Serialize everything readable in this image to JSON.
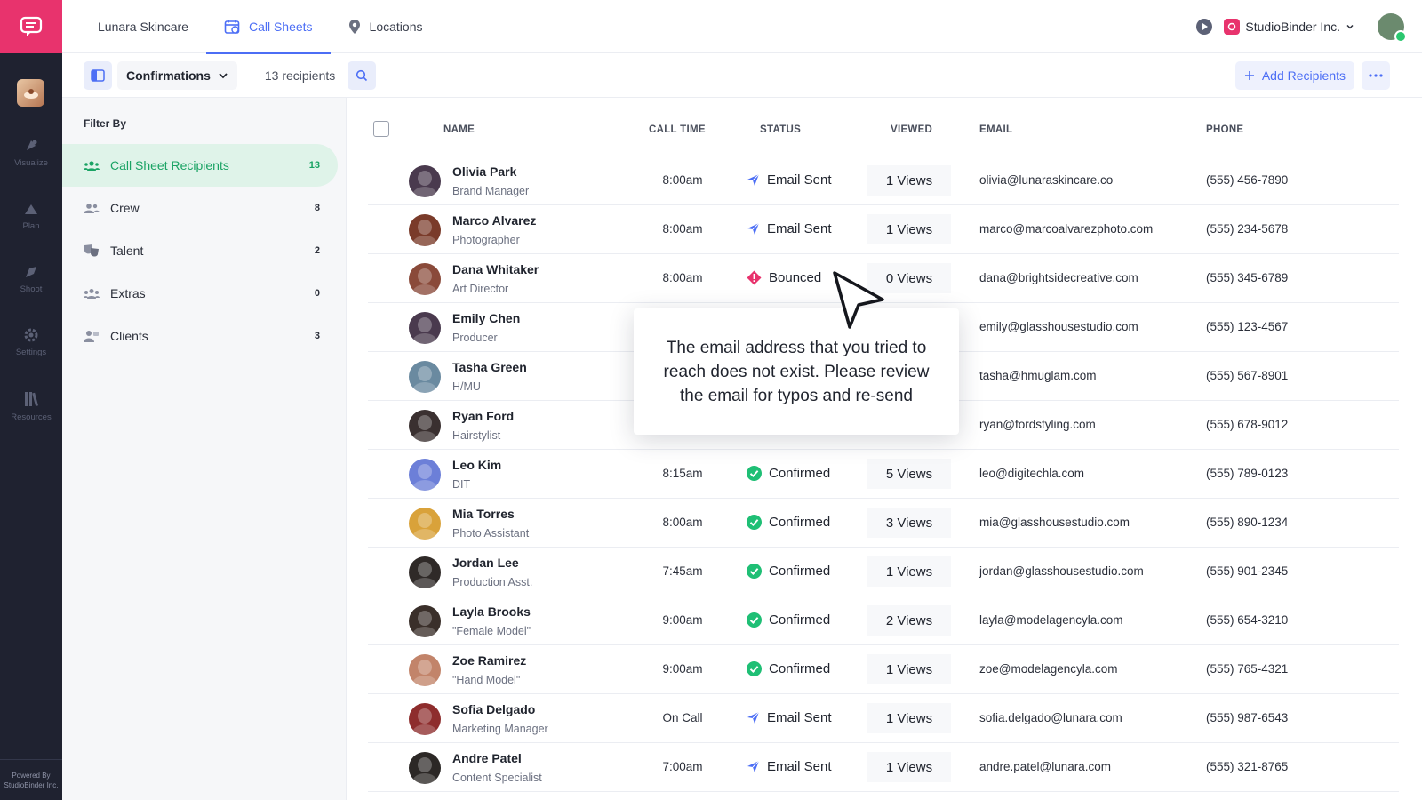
{
  "rail": {
    "items": [
      {
        "label": "Visualize",
        "icon": "visualize-icon"
      },
      {
        "label": "Plan",
        "icon": "plan-icon"
      },
      {
        "label": "Shoot",
        "icon": "shoot-icon"
      },
      {
        "label": "Settings",
        "icon": "gear-icon"
      },
      {
        "label": "Resources",
        "icon": "resources-icon"
      }
    ],
    "powered_line1": "Powered By",
    "powered_line2": "StudioBinder Inc."
  },
  "nav": {
    "project": "Lunara Skincare",
    "tabs": [
      {
        "label": "Call Sheets",
        "icon": "calendar-icon",
        "active": true
      },
      {
        "label": "Locations",
        "icon": "location-pin-icon",
        "active": false
      }
    ],
    "org_name": "StudioBinder Inc."
  },
  "toolbar": {
    "view_label": "Confirmations",
    "recipient_count": "13 recipients",
    "add_label": "Add Recipients"
  },
  "filters": {
    "title": "Filter By",
    "items": [
      {
        "label": "Call Sheet Recipients",
        "count": "13",
        "active": true
      },
      {
        "label": "Crew",
        "count": "8"
      },
      {
        "label": "Talent",
        "count": "2"
      },
      {
        "label": "Extras",
        "count": "0"
      },
      {
        "label": "Clients",
        "count": "3"
      }
    ]
  },
  "table": {
    "headers": {
      "name": "NAME",
      "call_time": "CALL TIME",
      "status": "STATUS",
      "viewed": "VIEWED",
      "email": "EMAIL",
      "phone": "PHONE"
    },
    "rows": [
      {
        "name": "Olivia Park",
        "role": "Brand Manager",
        "call_time": "8:00am",
        "status": "Email Sent",
        "views": "1 Views",
        "email": "olivia@lunaraskincare.co",
        "phone": "(555) 456-7890"
      },
      {
        "name": "Marco Alvarez",
        "role": "Photographer",
        "call_time": "8:00am",
        "status": "Email Sent",
        "views": "1 Views",
        "email": "marco@marcoalvarezphoto.com",
        "phone": "(555) 234-5678"
      },
      {
        "name": "Dana Whitaker",
        "role": "Art Director",
        "call_time": "8:00am",
        "status": "Bounced",
        "views": "0 Views",
        "email": "dana@brightsidecreative.com",
        "phone": "(555) 345-6789"
      },
      {
        "name": "Emily Chen",
        "role": "Producer",
        "call_time": "",
        "status": "",
        "views": "",
        "email": "emily@glasshousestudio.com",
        "phone": "(555) 123-4567"
      },
      {
        "name": "Tasha Green",
        "role": "H/MU",
        "call_time": "",
        "status": "",
        "views": "",
        "email": "tasha@hmuglam.com",
        "phone": "(555) 567-8901"
      },
      {
        "name": "Ryan Ford",
        "role": "Hairstylist",
        "call_time": "",
        "status": "",
        "views": "",
        "email": "ryan@fordstyling.com",
        "phone": "(555) 678-9012"
      },
      {
        "name": "Leo Kim",
        "role": "DIT",
        "call_time": "8:15am",
        "status": "Confirmed",
        "views": "5 Views",
        "email": "leo@digitechla.com",
        "phone": "(555) 789-0123"
      },
      {
        "name": "Mia Torres",
        "role": "Photo Assistant",
        "call_time": "8:00am",
        "status": "Confirmed",
        "views": "3 Views",
        "email": "mia@glasshousestudio.com",
        "phone": "(555) 890-1234"
      },
      {
        "name": "Jordan Lee",
        "role": "Production Asst.",
        "call_time": "7:45am",
        "status": "Confirmed",
        "views": "1 Views",
        "email": "jordan@glasshousestudio.com",
        "phone": "(555) 901-2345"
      },
      {
        "name": "Layla Brooks",
        "role": "\"Female Model\"",
        "call_time": "9:00am",
        "status": "Confirmed",
        "views": "2 Views",
        "email": "layla@modelagencyla.com",
        "phone": "(555) 654-3210"
      },
      {
        "name": "Zoe Ramirez",
        "role": "\"Hand Model\"",
        "call_time": "9:00am",
        "status": "Confirmed",
        "views": "1 Views",
        "email": "zoe@modelagencyla.com",
        "phone": "(555) 765-4321"
      },
      {
        "name": "Sofia Delgado",
        "role": "Marketing Manager",
        "call_time": "On Call",
        "status": "Email Sent",
        "views": "1 Views",
        "email": "sofia.delgado@lunara.com",
        "phone": "(555) 987-6543"
      },
      {
        "name": "Andre Patel",
        "role": "Content Specialist",
        "call_time": "7:00am",
        "status": "Email Sent",
        "views": "1 Views",
        "email": "andre.patel@lunara.com",
        "phone": "(555) 321-8765"
      }
    ]
  },
  "tooltip": {
    "text": "The email address that you tried to reach does not exist. Please review the email for typos and re-send"
  },
  "colors": {
    "accent": "#4c6ef5",
    "brand": "#e8336d",
    "confirmed": "#1fbf75",
    "bounced": "#e8336d",
    "rail_bg": "#1f2230"
  }
}
